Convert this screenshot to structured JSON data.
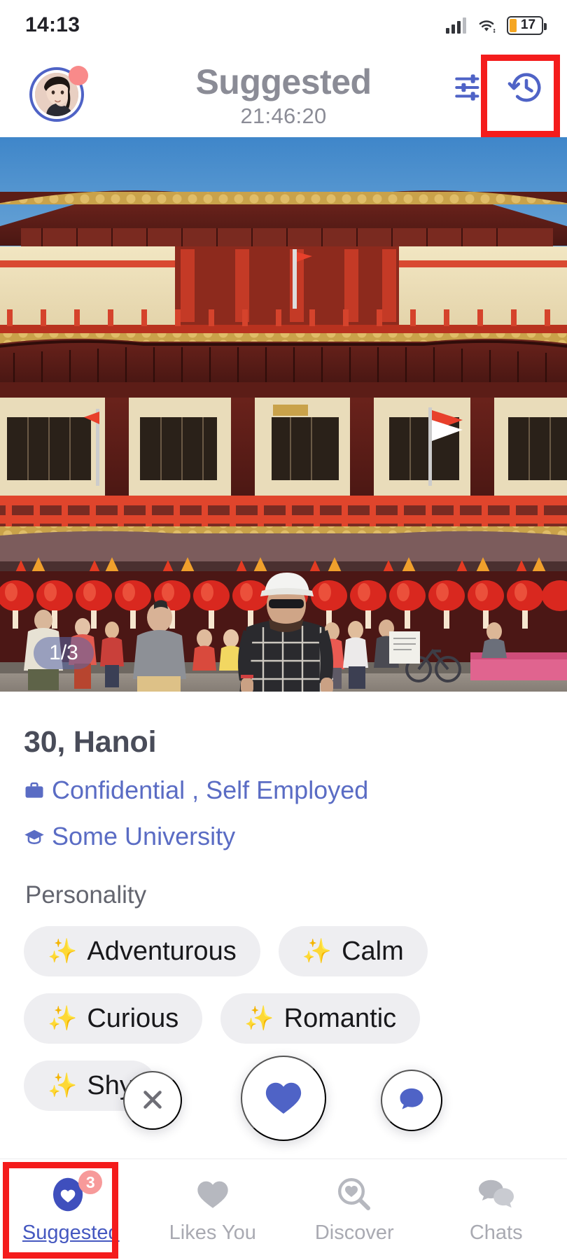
{
  "status_bar": {
    "time": "14:13",
    "battery_percent": "17",
    "signal_icon": "cellular-signal-icon",
    "wifi_icon": "wifi-icon",
    "battery_icon": "battery-icon"
  },
  "header": {
    "title": "Suggested",
    "timer": "21:46:20",
    "avatar_name": "user-avatar",
    "avatar_notification": true,
    "filter_icon": "filter-tune-icon",
    "history_icon": "history-clock-icon"
  },
  "photo": {
    "counter": "1/3",
    "alt": "chinese-temple-photo"
  },
  "profile": {
    "name_age_location": "30, Hanoi",
    "job": "Confidential , Self Employed",
    "job_icon": "briefcase-icon",
    "education": "Some University",
    "education_icon": "graduation-cap-icon",
    "section_label": "Personality",
    "personality_rows": [
      [
        {
          "spark": "✨",
          "label": "Adventurous"
        },
        {
          "spark": "✨",
          "label": "Calm"
        }
      ],
      [
        {
          "spark": "✨",
          "label": "Curious"
        },
        {
          "spark": "✨",
          "label": "Romantic"
        }
      ],
      [
        {
          "spark": "✨",
          "label": "Shy"
        }
      ]
    ]
  },
  "actions": {
    "pass_icon": "close-x-icon",
    "like_icon": "heart-icon",
    "chat_icon": "chat-bubble-icon"
  },
  "bottom_nav": {
    "items": [
      {
        "label": "Suggested",
        "icon": "suggested-heart-icon",
        "badge": "3",
        "active": true
      },
      {
        "label": "Likes You",
        "icon": "heart-icon",
        "badge": "",
        "active": false
      },
      {
        "label": "Discover",
        "icon": "search-heart-icon",
        "badge": "",
        "active": false
      },
      {
        "label": "Chats",
        "icon": "chat-bubbles-icon",
        "badge": "",
        "active": false
      }
    ]
  },
  "colors": {
    "accent_blue": "#4f63c6",
    "muted_gray": "#8b8c96",
    "badge_pink": "#f79a9a",
    "highlight_red": "#f41c1c",
    "battery_orange": "#f5a623"
  }
}
